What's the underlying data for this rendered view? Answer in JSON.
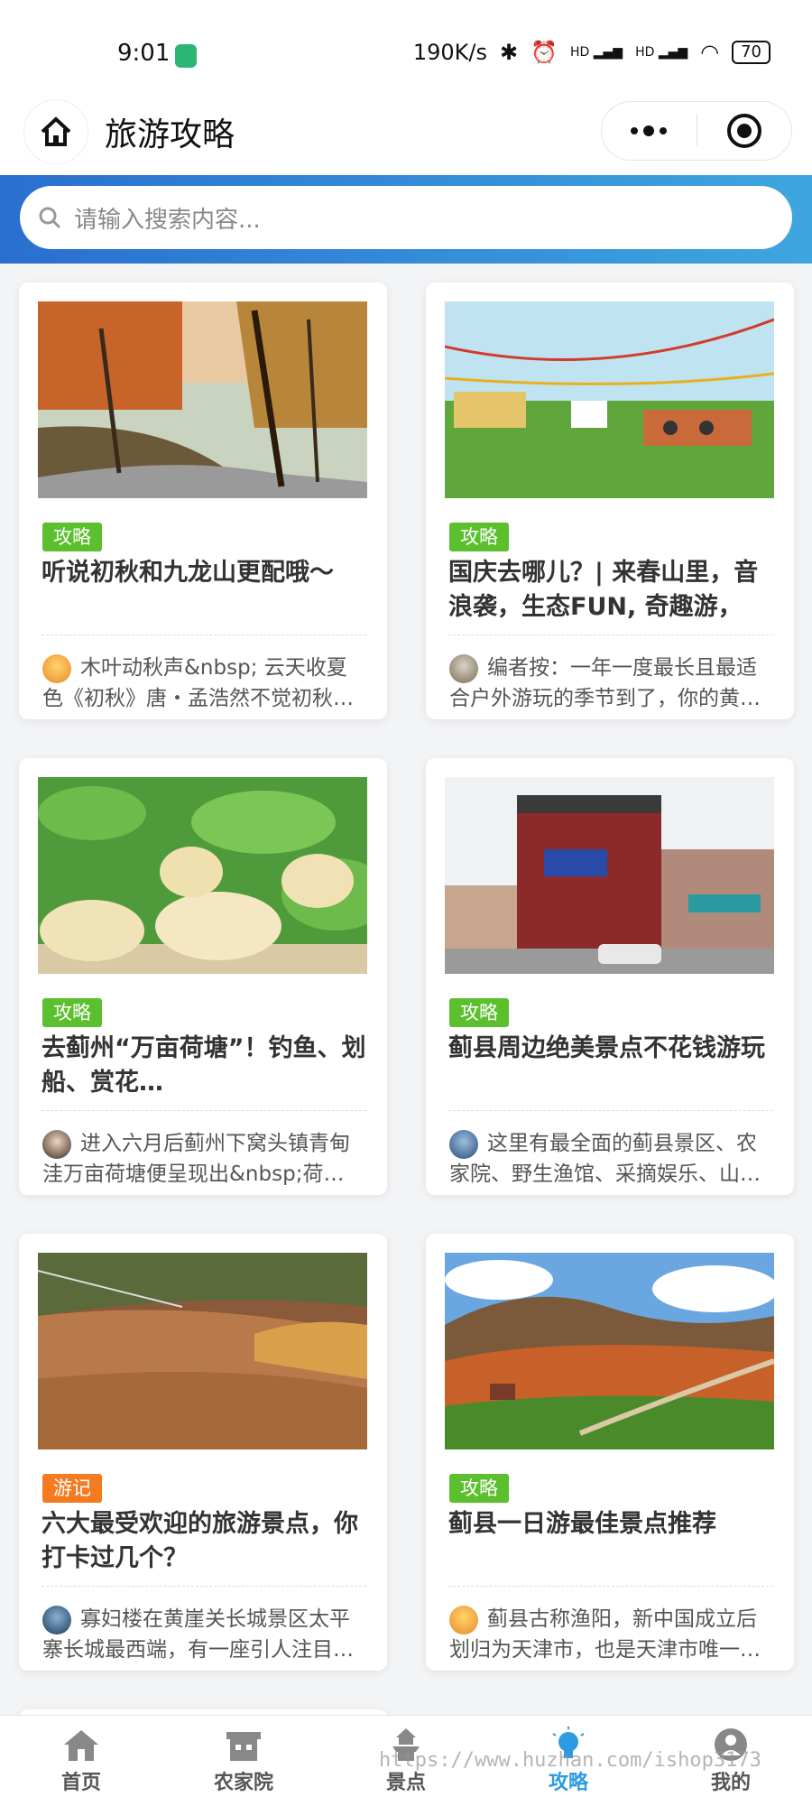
{
  "status_bar": {
    "time": "9:01",
    "net_speed": "190K/s",
    "hd1": "HD",
    "hd2": "HD",
    "battery": "70"
  },
  "nav": {
    "title": "旅游攻略"
  },
  "search": {
    "placeholder": "请输入搜索内容..."
  },
  "cards": [
    {
      "tag": "攻略",
      "tag_color": "#5bbf2e",
      "title": "听说初秋和九龙山更配哦～",
      "excerpt": "木叶动秋声&nbsp; 云天收夏色《初秋》唐・孟浩然不觉初秋…"
    },
    {
      "tag": "攻略",
      "tag_color": "#5bbf2e",
      "title": "国庆去哪儿？| 来春山里，音浪袭，生态FUN, 奇趣游，纵…",
      "excerpt": "编者按：一年一度最长且最适合户外游玩的季节到了，你的黄…"
    },
    {
      "tag": "攻略",
      "tag_color": "#5bbf2e",
      "title": "去蓟州“万亩荷塘”！钓鱼、划船、赏花…",
      "excerpt": "进入六月后蓟州下窝头镇青甸洼万亩荷塘便呈现出&nbsp;荷…"
    },
    {
      "tag": "攻略",
      "tag_color": "#5bbf2e",
      "title": "蓟县周边绝美景点不花钱游玩",
      "excerpt": "这里有最全面的蓟县景区、农家院、野生渔馆、采摘娱乐、山…"
    },
    {
      "tag": "游记",
      "tag_color": "#f47b20",
      "title": "六大最受欢迎的旅游景点，你打卡过几个？",
      "excerpt": "寡妇楼在黄崖关长城景区太平寨长城最西端，有一座引人注目…"
    },
    {
      "tag": "攻略",
      "tag_color": "#5bbf2e",
      "title": "蓟县一日游最佳景点推荐",
      "excerpt": "蓟县古称渔阳，新中国成立后划归为天津市，也是天津市唯一…"
    }
  ],
  "tabs": [
    {
      "label": "首页",
      "icon": "home-icon"
    },
    {
      "label": "农家院",
      "icon": "farmhouse-icon"
    },
    {
      "label": "景点",
      "icon": "pagoda-icon"
    },
    {
      "label": "攻略",
      "icon": "lightbulb-icon",
      "active": true
    },
    {
      "label": "我的",
      "icon": "user-icon"
    }
  ],
  "watermark": "https://www.huzhan.com/ishop3173",
  "colors": {
    "accent": "#2e9be0",
    "tag_green": "#5bbf2e",
    "tag_orange": "#f47b20",
    "search_band_start": "#2a6fcf",
    "search_band_end": "#3ea6de"
  }
}
